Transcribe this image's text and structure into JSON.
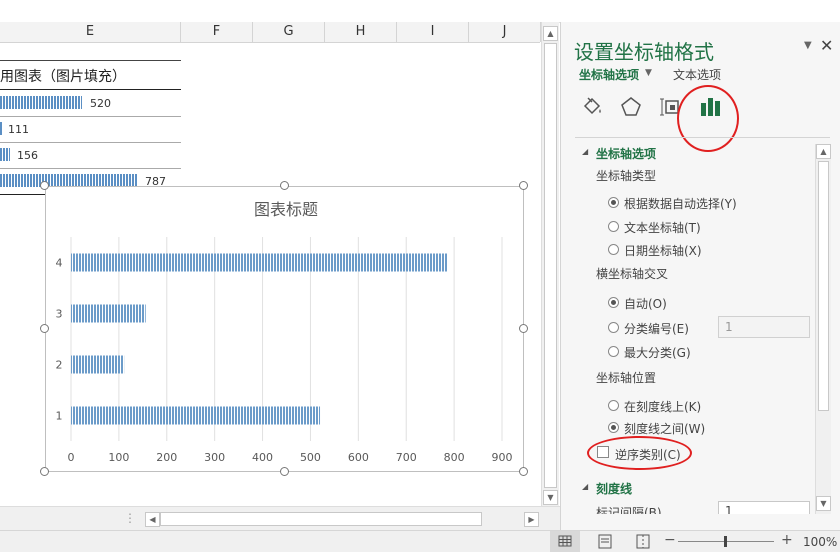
{
  "columns": [
    "E",
    "F",
    "G",
    "H",
    "I",
    "J"
  ],
  "sheet": {
    "title_fragment": "用图表（图片填充）",
    "rows": [
      {
        "value": "520"
      },
      {
        "value": "111"
      },
      {
        "value": "156"
      },
      {
        "value": "787"
      }
    ]
  },
  "chart_data": {
    "type": "bar",
    "title": "图表标题",
    "categories": [
      "1",
      "2",
      "3",
      "4"
    ],
    "values": [
      520,
      111,
      156,
      787
    ],
    "xticks": [
      "0",
      "100",
      "200",
      "300",
      "400",
      "500",
      "600",
      "700",
      "800",
      "900"
    ],
    "xlim": [
      0,
      900
    ],
    "grid": true,
    "bar_color": "#6b9bc9"
  },
  "pane": {
    "title": "设置坐标轴格式",
    "tab_axis_options": "坐标轴选项",
    "tab_text_options": "文本选项",
    "section_axis_options": "坐标轴选项",
    "axis_type_label": "坐标轴类型",
    "axis_type_options": [
      "根据数据自动选择(Y)",
      "文本坐标轴(T)",
      "日期坐标轴(X)"
    ],
    "cross_label": "横坐标轴交叉",
    "cross_options": [
      "自动(O)",
      "分类编号(E)",
      "最大分类(G)"
    ],
    "cross_value": "1",
    "position_label": "坐标轴位置",
    "position_options": [
      "在刻度线上(K)",
      "刻度线之间(W)"
    ],
    "reverse_label": "逆序类别(C)",
    "section_tick": "刻度线",
    "tick_interval_label": "标记间隔(B)",
    "tick_interval_value": "1",
    "accent": "#217346",
    "highlight": "#e02020"
  },
  "statusbar": {
    "zoom": "100%"
  }
}
